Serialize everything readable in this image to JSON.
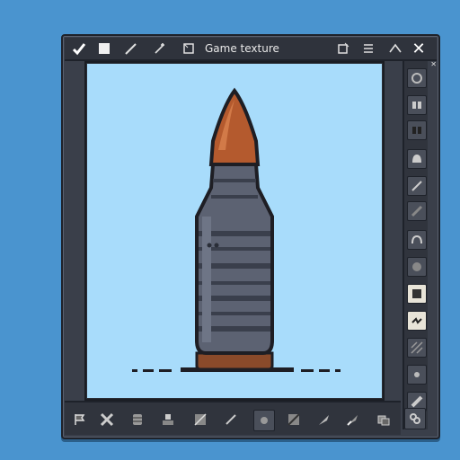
{
  "window": {
    "title": "Game texture",
    "close_glyph": "✕"
  },
  "titlebar_icons": [
    "check-icon",
    "square-icon",
    "pencil-icon",
    "wand-icon",
    "frame-icon",
    "crop-icon",
    "menu-icon",
    "arrow-icon"
  ],
  "right_panel_icons": [
    "grid-icon",
    "pair-icon",
    "pair-dark-icon",
    "helmet-icon",
    "line-icon",
    "slash-icon",
    "dome-icon",
    "circle-icon",
    "frame-selected-icon",
    "link-selected-icon",
    "hatch-icon",
    "dot-icon",
    "diagonal-icon"
  ],
  "bottom_toolbar_icons": [
    "flag-icon",
    "cross-icon",
    "barrel-icon",
    "stamp-icon",
    "square-slash-icon",
    "brush-icon",
    "dot-icon",
    "square-diag-icon",
    "bullet-icon",
    "bullet-alt-icon",
    "layers-icon",
    "chain-icon"
  ],
  "colors": {
    "background": "#4a94cf",
    "canvas": "#a8dcfb",
    "bullet_tip": "#b45a2e",
    "bullet_casing": "#5a6070",
    "bullet_rim": "#8a4a2a"
  }
}
